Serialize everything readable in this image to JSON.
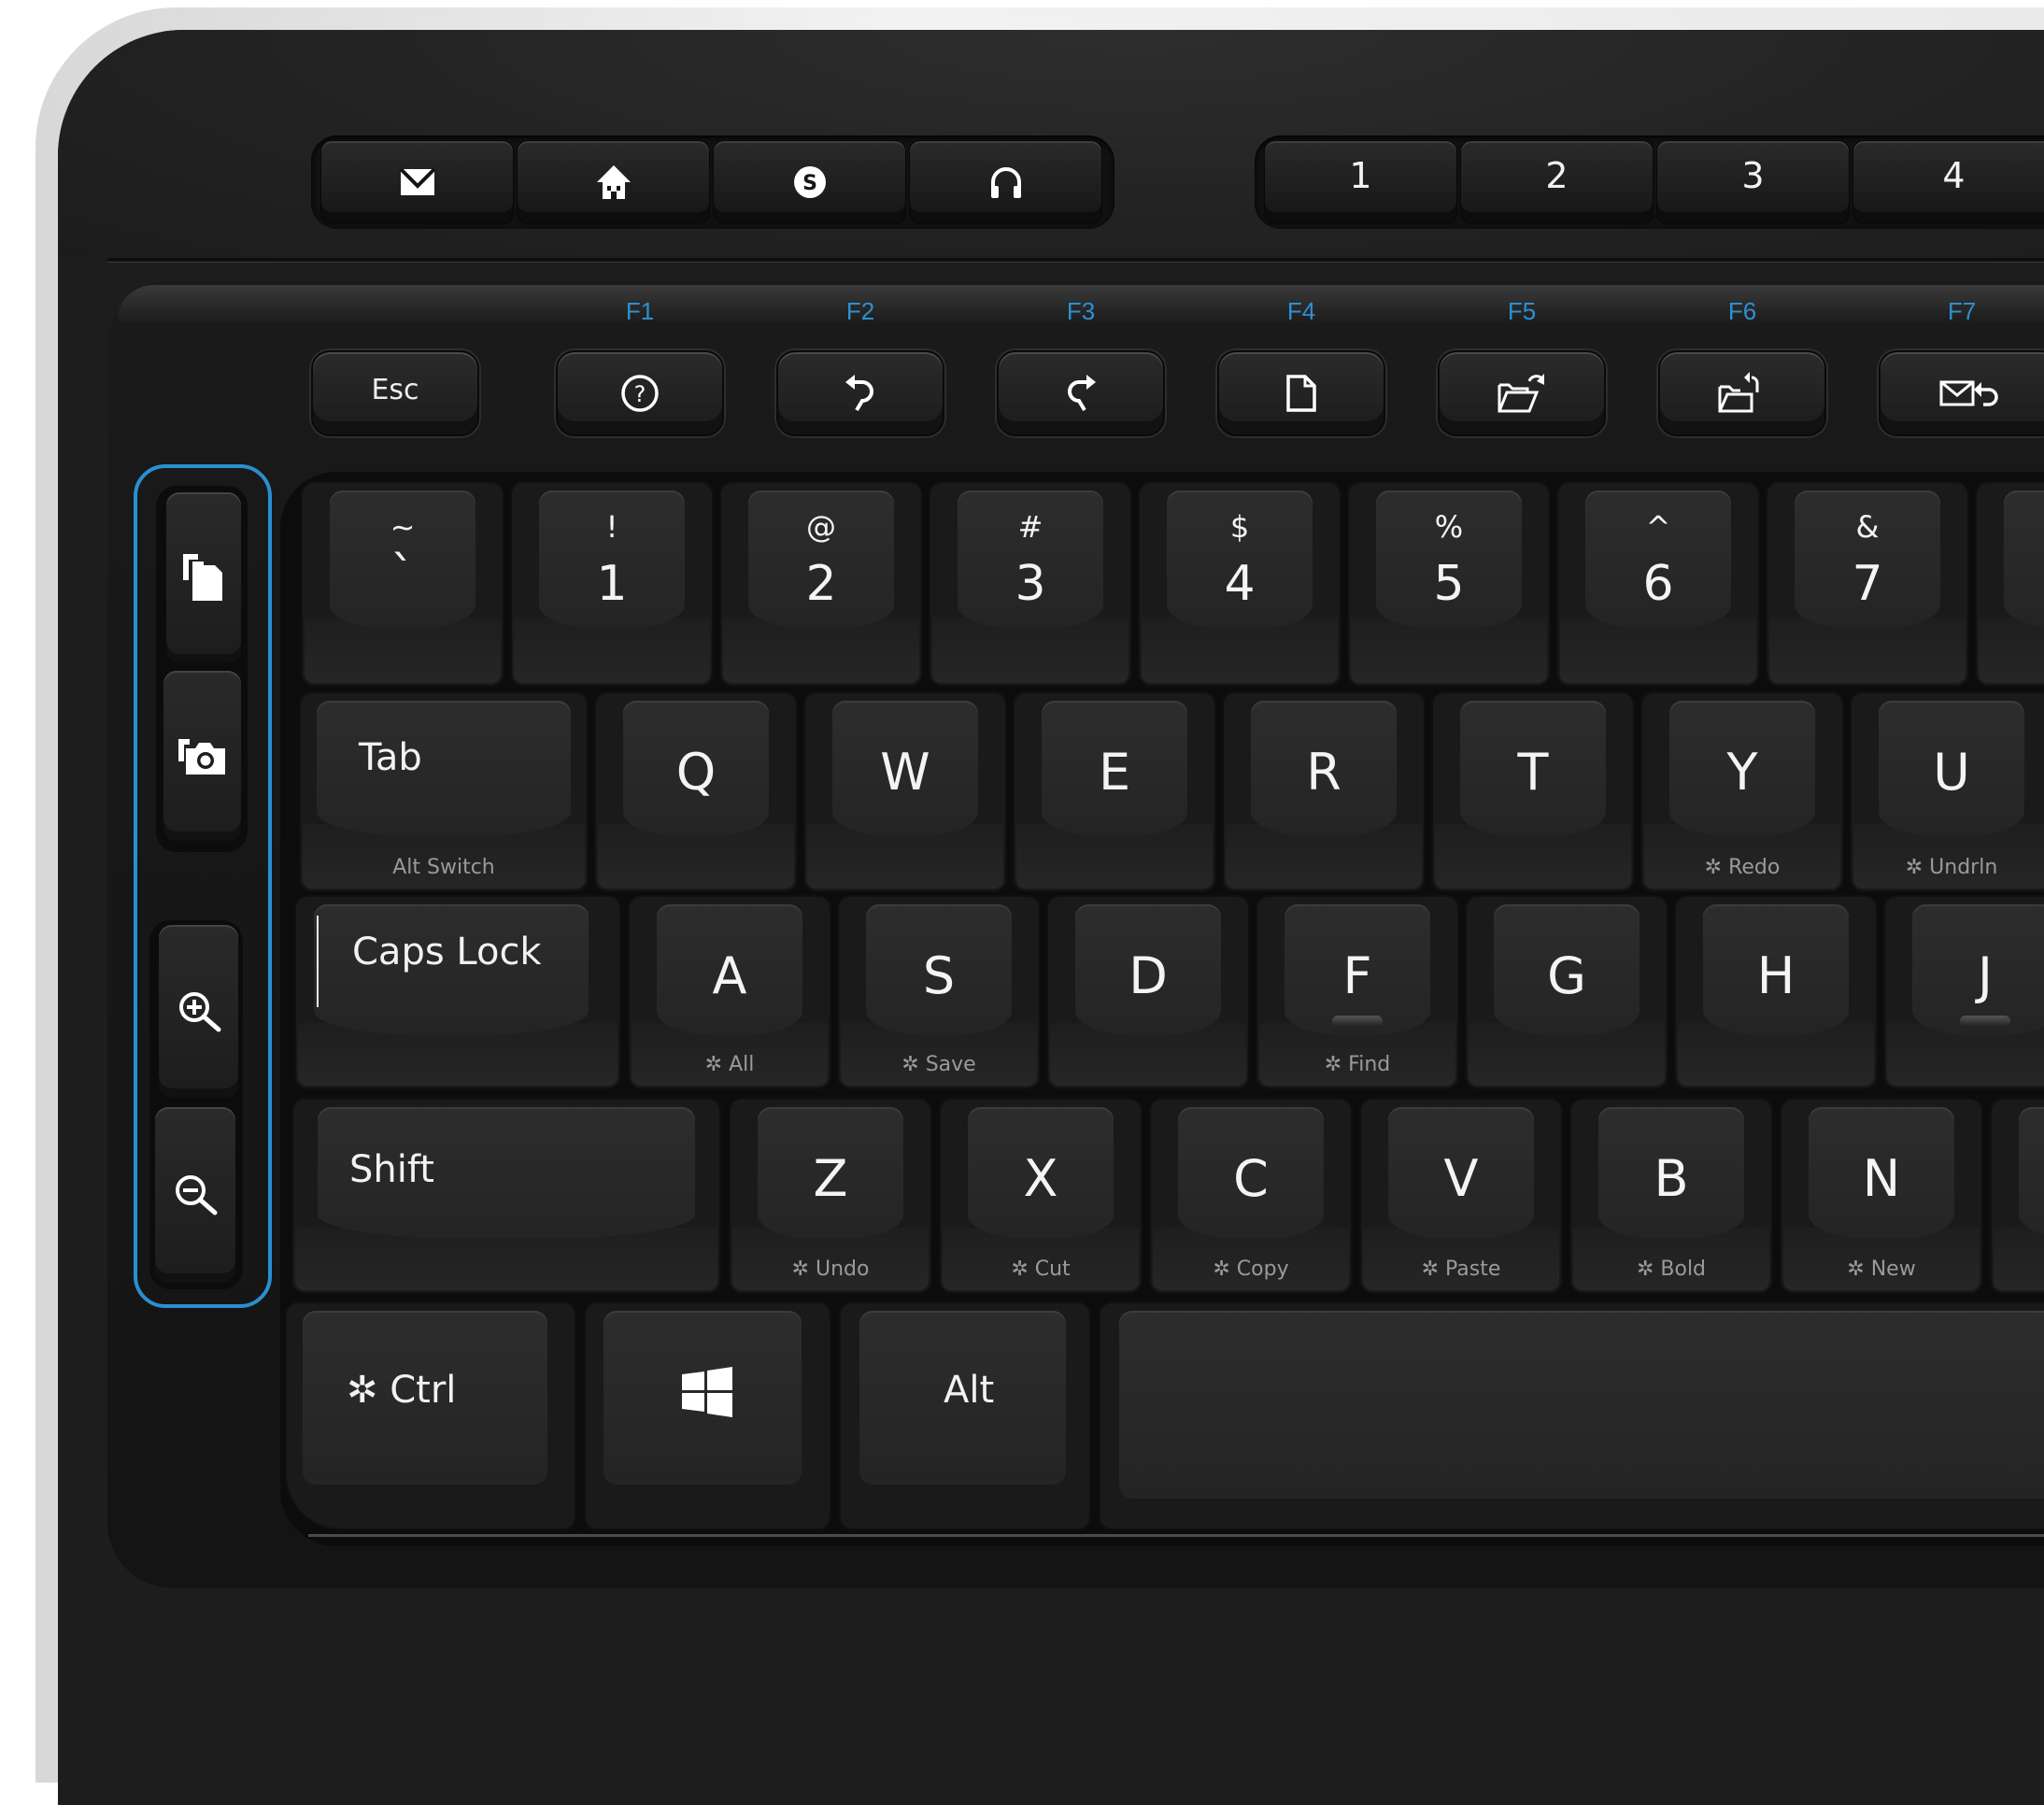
{
  "media_keys": [
    {
      "name": "mail",
      "icon": "mail-icon"
    },
    {
      "name": "home",
      "icon": "home-icon"
    },
    {
      "name": "skype",
      "icon": "skype-icon"
    },
    {
      "name": "music",
      "icon": "headphones-icon"
    }
  ],
  "favorite_keys": [
    "1",
    "2",
    "3",
    "4"
  ],
  "function_row": {
    "esc_label": "Esc",
    "keys": [
      {
        "fn": "F1",
        "icon": "help-icon"
      },
      {
        "fn": "F2",
        "icon": "undo-icon"
      },
      {
        "fn": "F3",
        "icon": "redo-icon"
      },
      {
        "fn": "F4",
        "icon": "new-document-icon"
      },
      {
        "fn": "F5",
        "icon": "open-folder-icon"
      },
      {
        "fn": "F6",
        "icon": "save-folder-icon"
      },
      {
        "fn": "F7",
        "icon": "reply-mail-icon"
      }
    ]
  },
  "side_keys": [
    {
      "name": "app-switch",
      "icon": "windows-stack-icon"
    },
    {
      "name": "screenshot",
      "icon": "camera-icon"
    },
    {
      "name": "zoom-in",
      "icon": "zoom-in-icon"
    },
    {
      "name": "zoom-out",
      "icon": "zoom-out-icon"
    }
  ],
  "number_row": [
    {
      "shift": "~",
      "base": "`"
    },
    {
      "shift": "!",
      "base": "1"
    },
    {
      "shift": "@",
      "base": "2"
    },
    {
      "shift": "#",
      "base": "3"
    },
    {
      "shift": "$",
      "base": "4"
    },
    {
      "shift": "%",
      "base": "5"
    },
    {
      "shift": "^",
      "base": "6"
    },
    {
      "shift": "&",
      "base": "7"
    }
  ],
  "tab_row": {
    "tab_label": "Tab",
    "tab_sub": "Alt Switch",
    "keys": [
      {
        "letter": "Q",
        "sub": ""
      },
      {
        "letter": "W",
        "sub": ""
      },
      {
        "letter": "E",
        "sub": ""
      },
      {
        "letter": "R",
        "sub": ""
      },
      {
        "letter": "T",
        "sub": ""
      },
      {
        "letter": "Y",
        "sub": "✲ Redo"
      },
      {
        "letter": "U",
        "sub": "✲ Undrln"
      }
    ]
  },
  "caps_row": {
    "caps_label": "Caps Lock",
    "keys": [
      {
        "letter": "A",
        "sub": "✲ All"
      },
      {
        "letter": "S",
        "sub": "✲ Save"
      },
      {
        "letter": "D",
        "sub": ""
      },
      {
        "letter": "F",
        "sub": "✲ Find"
      },
      {
        "letter": "G",
        "sub": ""
      },
      {
        "letter": "H",
        "sub": ""
      },
      {
        "letter": "J",
        "sub": ""
      }
    ]
  },
  "shift_row": {
    "shift_label": "Shift",
    "keys": [
      {
        "letter": "Z",
        "sub": "✲ Undo"
      },
      {
        "letter": "X",
        "sub": "✲ Cut"
      },
      {
        "letter": "C",
        "sub": "✲ Copy"
      },
      {
        "letter": "V",
        "sub": "✲ Paste"
      },
      {
        "letter": "B",
        "sub": "✲ Bold"
      },
      {
        "letter": "N",
        "sub": "✲ New"
      }
    ]
  },
  "bottom_row": {
    "ctrl_label": "✲ Ctrl",
    "win_icon": "windows-logo-icon",
    "alt_label": "Alt"
  },
  "colors": {
    "fn_label": "#2f8fd0",
    "side_outline": "#2a8fd0",
    "key_legend": "#f2f2f2",
    "sub_legend": "#9a9a9a"
  }
}
